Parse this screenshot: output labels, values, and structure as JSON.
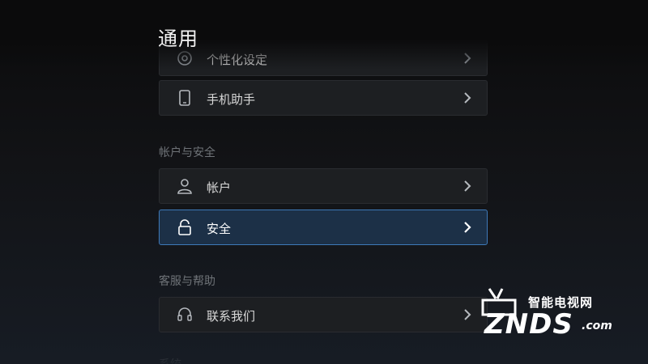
{
  "page": {
    "title": "通用"
  },
  "sections": [
    {
      "title": "",
      "items": [
        {
          "label": "个性化设定",
          "icon": "personalize-icon"
        },
        {
          "label": "手机助手",
          "icon": "phone-icon"
        }
      ]
    },
    {
      "title": "帐户与安全",
      "items": [
        {
          "label": "帐户",
          "icon": "user-icon"
        },
        {
          "label": "安全",
          "icon": "lock-icon",
          "selected": true
        }
      ]
    },
    {
      "title": "客服与帮助",
      "items": [
        {
          "label": "联系我们",
          "icon": "headset-icon"
        }
      ]
    },
    {
      "title": "系统",
      "items": []
    }
  ],
  "watermark": {
    "cn": "智能电视网",
    "brand": "ZNDS",
    "suffix": ".com"
  },
  "colors": {
    "selected_border": "#3e79b8",
    "selected_bg": "#1c3047"
  }
}
